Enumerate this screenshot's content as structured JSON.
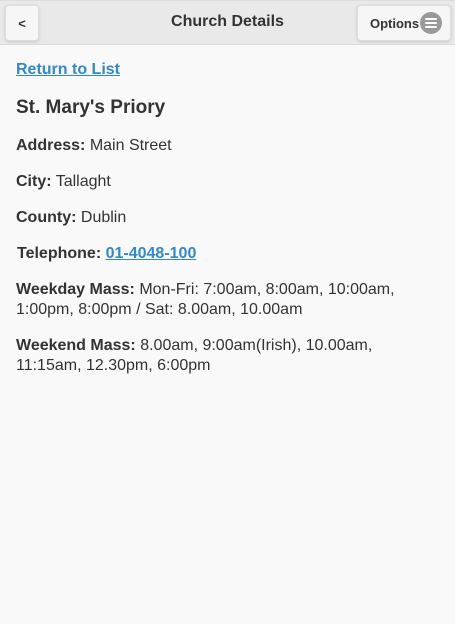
{
  "header": {
    "title": "Church Details",
    "back_label": "<",
    "options_label": "Options",
    "options_icon": "menu-icon"
  },
  "content": {
    "return_link": "Return to List",
    "church_name": "St. Mary's Priory",
    "fields": {
      "address_label": "Address:",
      "address_value": "Main Street",
      "city_label": "City:",
      "city_value": "Tallaght",
      "county_label": "County:",
      "county_value": "Dublin",
      "telephone_label": "Telephone:",
      "telephone_value": "01-4048-100",
      "weekday_label": "Weekday Mass:",
      "weekday_value": "Mon-Fri: 7:00am, 8:00am, 10:00am, 1:00pm, 8:00pm / Sat: 8.00am, 10.00am",
      "weekend_label": "Weekend Mass:",
      "weekend_value": "8.00am, 9:00am(Irish), 10.00am, 11:15am, 12.30pm, 6:00pm"
    }
  },
  "colors": {
    "link": "#3388cc",
    "header_bg": "#e9e9e9",
    "page_bg": "#f9f9f9",
    "text": "#333333"
  }
}
